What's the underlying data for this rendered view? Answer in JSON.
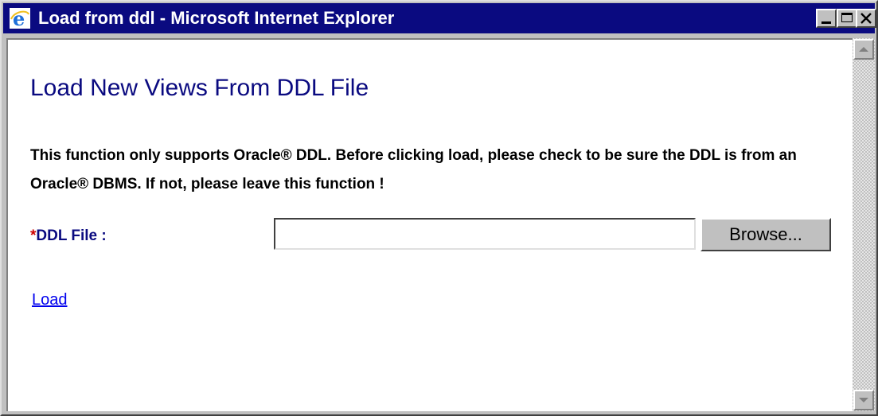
{
  "window": {
    "title": "Load from ddl - Microsoft Internet Explorer",
    "app_icon": "ie-icon",
    "controls": {
      "minimize_icon": "minimize-icon",
      "maximize_icon": "maximize-icon",
      "close_icon": "close-icon"
    },
    "colors": {
      "titlebar": "#0a0a80",
      "heading": "#0a0a80",
      "required": "#cc0000",
      "link": "#0000ee"
    }
  },
  "page": {
    "heading": "Load New Views From DDL File",
    "notice": "This function only supports Oracle® DDL. Before clicking load, please check to be sure the DDL is from an Oracle® DBMS. If not, please leave this function !",
    "form": {
      "required_marker": "*",
      "file_label": "DDL File :",
      "file_value": "",
      "browse_label": "Browse..."
    },
    "load_link": "Load"
  }
}
